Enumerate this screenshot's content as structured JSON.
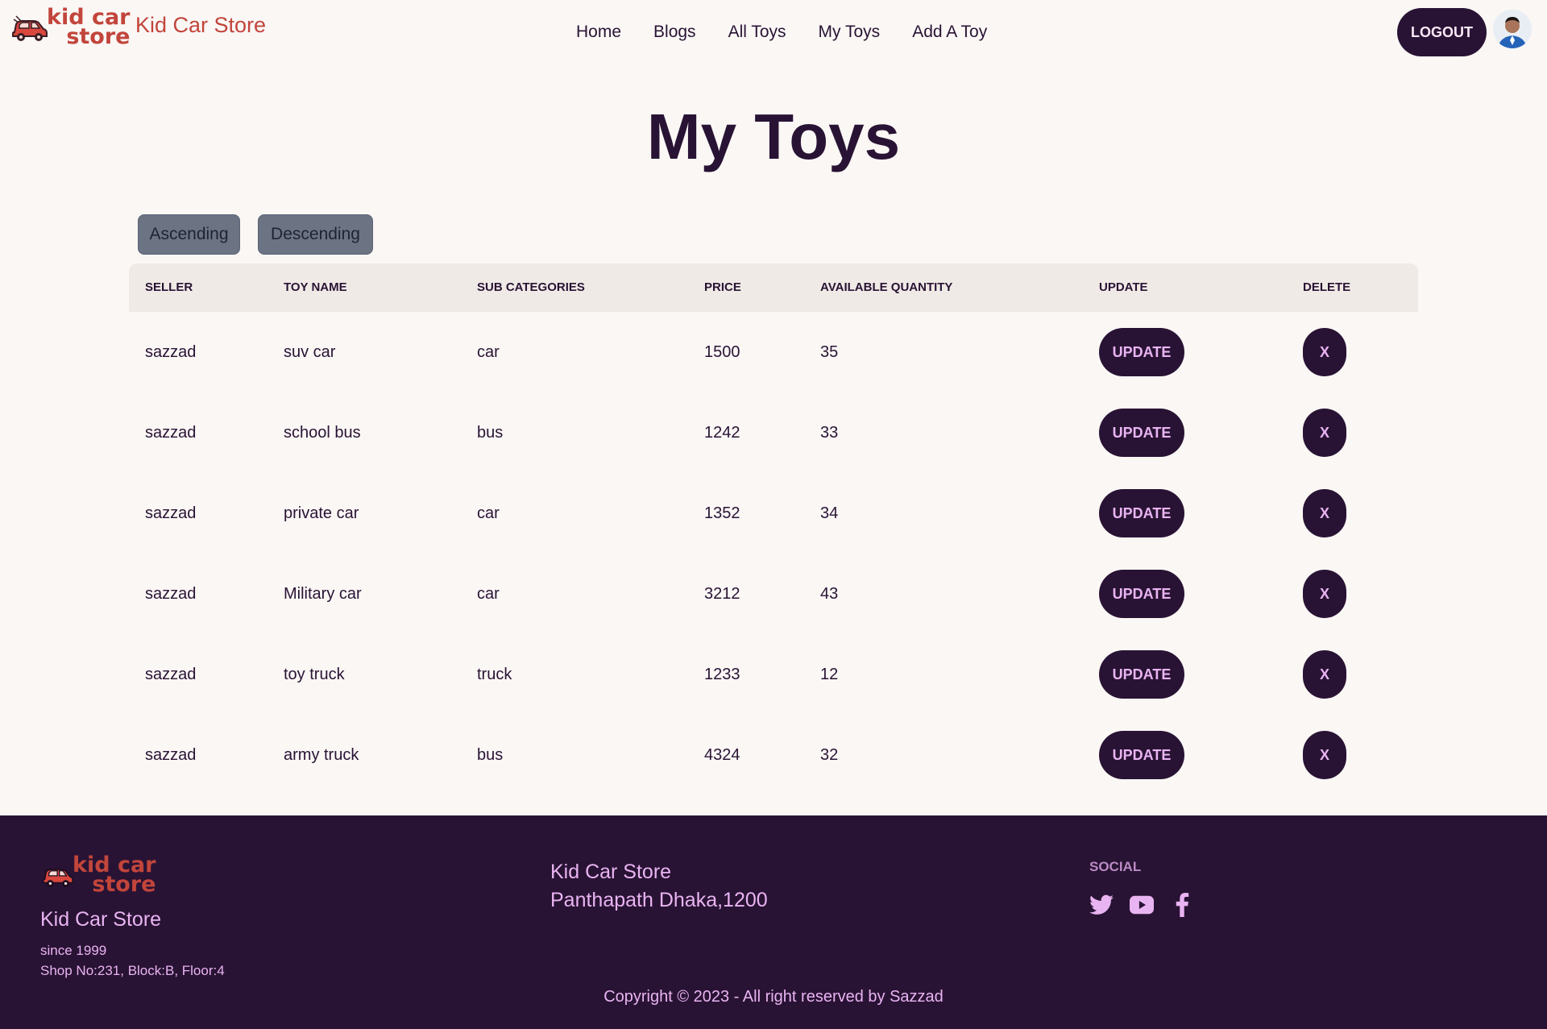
{
  "nav": {
    "logo_line1": "kid car",
    "logo_line2": "store",
    "brand": "Kid Car Store",
    "items": [
      {
        "label": "Home"
      },
      {
        "label": "Blogs"
      },
      {
        "label": "All Toys"
      },
      {
        "label": "My Toys"
      },
      {
        "label": "Add A Toy"
      }
    ],
    "logout_label": "LOGOUT"
  },
  "page": {
    "title": "My Toys",
    "sort_ascending": "Ascending",
    "sort_descending": "Descending"
  },
  "table": {
    "headers": [
      "SELLER",
      "TOY NAME",
      "SUB CATEGORIES",
      "PRICE",
      "AVAILABLE QUANTITY",
      "UPDATE",
      "DELETE"
    ],
    "rows": [
      {
        "seller": "sazzad",
        "name": "suv car",
        "sub": "car",
        "price": "1500",
        "qty": "35"
      },
      {
        "seller": "sazzad",
        "name": "school bus",
        "sub": "bus",
        "price": "1242",
        "qty": "33"
      },
      {
        "seller": "sazzad",
        "name": "private car",
        "sub": "car",
        "price": "1352",
        "qty": "34"
      },
      {
        "seller": "sazzad",
        "name": "Military car",
        "sub": "car",
        "price": "3212",
        "qty": "43"
      },
      {
        "seller": "sazzad",
        "name": "toy truck",
        "sub": "truck",
        "price": "1233",
        "qty": "12"
      },
      {
        "seller": "sazzad",
        "name": "army truck",
        "sub": "bus",
        "price": "4324",
        "qty": "32"
      }
    ],
    "update_label": "UPDATE",
    "delete_label": "X"
  },
  "footer": {
    "logo_line1": "kid car",
    "logo_line2": "store",
    "name": "Kid Car Store",
    "since": "since 1999",
    "shop": "Shop No:231, Block:B, Floor:4",
    "store": "Kid Car Store",
    "address": "Panthapath Dhaka,1200",
    "social_title": "SOCIAL",
    "social_icons": [
      "twitter-icon",
      "youtube-icon",
      "facebook-icon"
    ],
    "copyright": "Copyright © 2023 - All right reserved by Sazzad"
  },
  "colors": {
    "primary": "#291334",
    "accent": "#c2453b",
    "background": "#faf7f5",
    "footer_text": "#e9b4f2"
  }
}
